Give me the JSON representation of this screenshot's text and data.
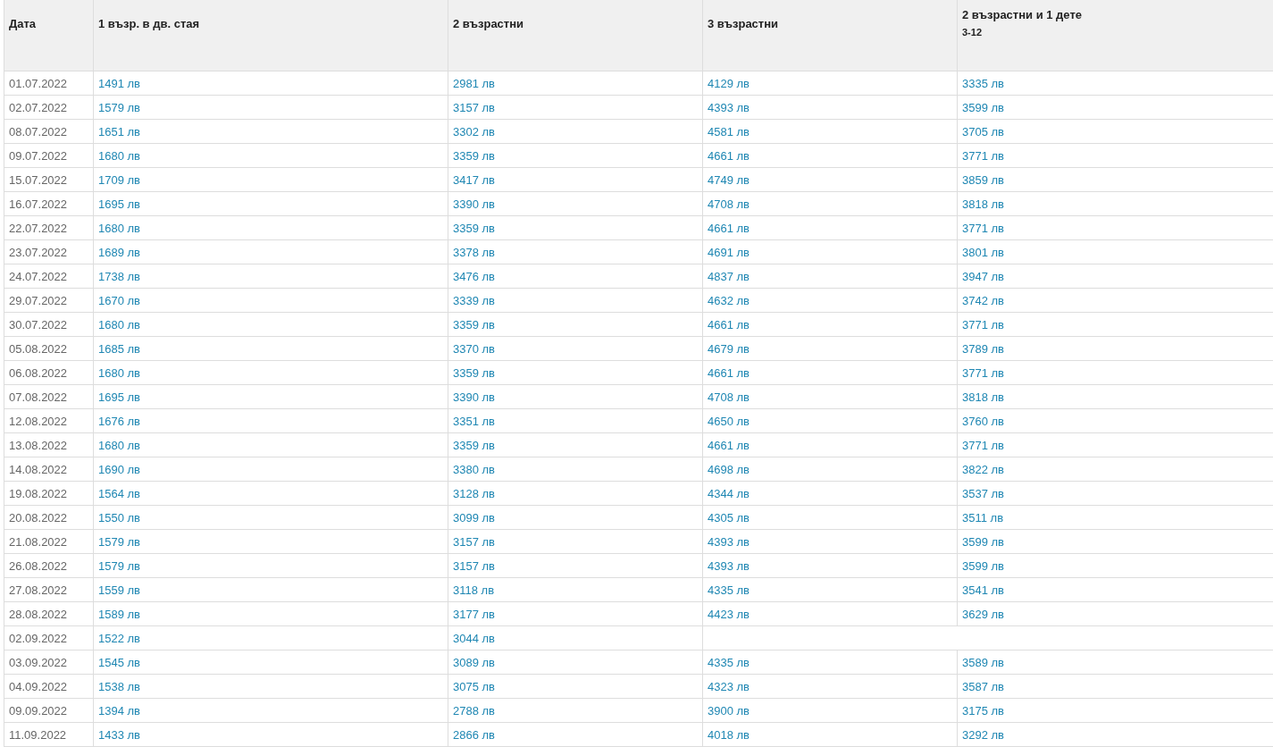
{
  "table": {
    "columns": [
      {
        "label": "Дата"
      },
      {
        "label": "1 възр. в дв. стая"
      },
      {
        "label": "2 възрастни"
      },
      {
        "label": "3 възрастни"
      },
      {
        "label": "2 възрастни и 1 дете",
        "note": "3-12"
      }
    ],
    "rows": [
      {
        "date": "01.07.2022",
        "prices": [
          "1491 лв",
          "2981 лв",
          "4129 лв",
          "3335 лв"
        ]
      },
      {
        "date": "02.07.2022",
        "prices": [
          "1579 лв",
          "3157 лв",
          "4393 лв",
          "3599 лв"
        ]
      },
      {
        "date": "08.07.2022",
        "prices": [
          "1651 лв",
          "3302 лв",
          "4581 лв",
          "3705 лв"
        ]
      },
      {
        "date": "09.07.2022",
        "prices": [
          "1680 лв",
          "3359 лв",
          "4661 лв",
          "3771 лв"
        ]
      },
      {
        "date": "15.07.2022",
        "prices": [
          "1709 лв",
          "3417 лв",
          "4749 лв",
          "3859 лв"
        ]
      },
      {
        "date": "16.07.2022",
        "prices": [
          "1695 лв",
          "3390 лв",
          "4708 лв",
          "3818 лв"
        ]
      },
      {
        "date": "22.07.2022",
        "prices": [
          "1680 лв",
          "3359 лв",
          "4661 лв",
          "3771 лв"
        ]
      },
      {
        "date": "23.07.2022",
        "prices": [
          "1689 лв",
          "3378 лв",
          "4691 лв",
          "3801 лв"
        ]
      },
      {
        "date": "24.07.2022",
        "prices": [
          "1738 лв",
          "3476 лв",
          "4837 лв",
          "3947 лв"
        ]
      },
      {
        "date": "29.07.2022",
        "prices": [
          "1670 лв",
          "3339 лв",
          "4632 лв",
          "3742 лв"
        ]
      },
      {
        "date": "30.07.2022",
        "prices": [
          "1680 лв",
          "3359 лв",
          "4661 лв",
          "3771 лв"
        ]
      },
      {
        "date": "05.08.2022",
        "prices": [
          "1685 лв",
          "3370 лв",
          "4679 лв",
          "3789 лв"
        ]
      },
      {
        "date": "06.08.2022",
        "prices": [
          "1680 лв",
          "3359 лв",
          "4661 лв",
          "3771 лв"
        ]
      },
      {
        "date": "07.08.2022",
        "prices": [
          "1695 лв",
          "3390 лв",
          "4708 лв",
          "3818 лв"
        ]
      },
      {
        "date": "12.08.2022",
        "prices": [
          "1676 лв",
          "3351 лв",
          "4650 лв",
          "3760 лв"
        ]
      },
      {
        "date": "13.08.2022",
        "prices": [
          "1680 лв",
          "3359 лв",
          "4661 лв",
          "3771 лв"
        ]
      },
      {
        "date": "14.08.2022",
        "prices": [
          "1690 лв",
          "3380 лв",
          "4698 лв",
          "3822 лв"
        ]
      },
      {
        "date": "19.08.2022",
        "prices": [
          "1564 лв",
          "3128 лв",
          "4344 лв",
          "3537 лв"
        ]
      },
      {
        "date": "20.08.2022",
        "prices": [
          "1550 лв",
          "3099 лв",
          "4305 лв",
          "3511 лв"
        ]
      },
      {
        "date": "21.08.2022",
        "prices": [
          "1579 лв",
          "3157 лв",
          "4393 лв",
          "3599 лв"
        ]
      },
      {
        "date": "26.08.2022",
        "prices": [
          "1579 лв",
          "3157 лв",
          "4393 лв",
          "3599 лв"
        ]
      },
      {
        "date": "27.08.2022",
        "prices": [
          "1559 лв",
          "3118 лв",
          "4335 лв",
          "3541 лв"
        ]
      },
      {
        "date": "28.08.2022",
        "prices": [
          "1589 лв",
          "3177 лв",
          "4423 лв",
          "3629 лв"
        ]
      },
      {
        "date": "02.09.2022",
        "prices": [
          "1522 лв",
          "3044 лв"
        ]
      },
      {
        "date": "03.09.2022",
        "prices": [
          "1545 лв",
          "3089 лв",
          "4335 лв",
          "3589 лв"
        ]
      },
      {
        "date": "04.09.2022",
        "prices": [
          "1538 лв",
          "3075 лв",
          "4323 лв",
          "3587 лв"
        ]
      },
      {
        "date": "09.09.2022",
        "prices": [
          "1394 лв",
          "2788 лв",
          "3900 лв",
          "3175 лв"
        ]
      },
      {
        "date": "11.09.2022",
        "prices": [
          "1433 лв",
          "2866 лв",
          "4018 лв",
          "3292 лв"
        ]
      }
    ]
  }
}
